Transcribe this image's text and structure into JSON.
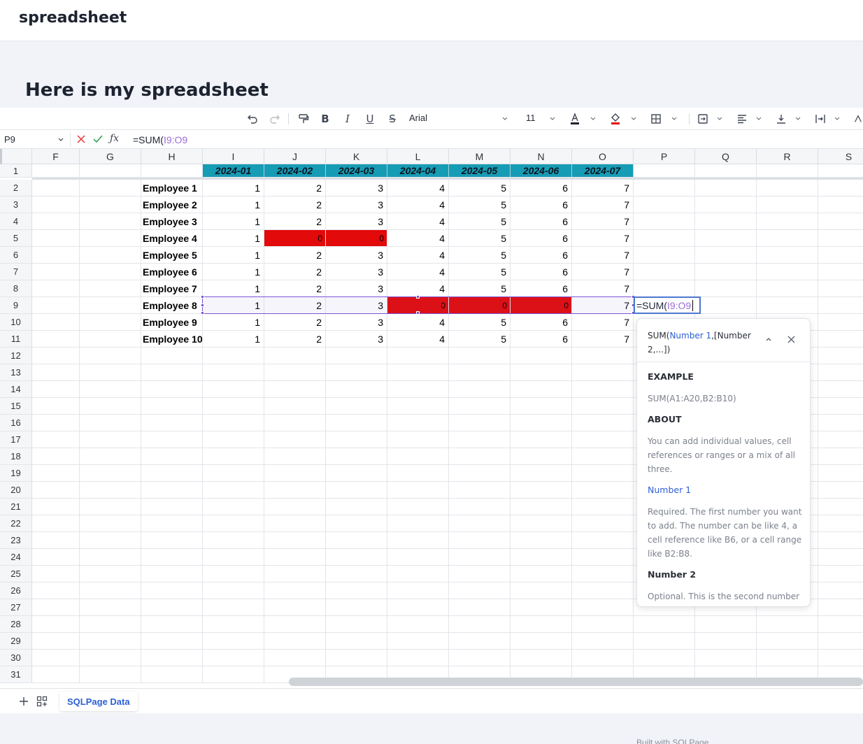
{
  "app": {
    "brand": "spreadsheet",
    "page_title": "Here is my spreadsheet",
    "footer": "Built with SQLPage"
  },
  "toolbar": {
    "font": "Arial",
    "font_size": "11"
  },
  "formula_bar": {
    "name_box": "P9",
    "formula_prefix": "=SUM(",
    "formula_ref": "I9:O9"
  },
  "columns": [
    "F",
    "G",
    "H",
    "I",
    "J",
    "K",
    "L",
    "M",
    "N",
    "O",
    "P",
    "Q",
    "R",
    "S"
  ],
  "rows": [
    "1",
    "2",
    "3",
    "4",
    "5",
    "6",
    "7",
    "8",
    "9",
    "10",
    "11",
    "12",
    "13",
    "14",
    "15",
    "16",
    "17",
    "18",
    "19",
    "20",
    "21",
    "22",
    "23",
    "24",
    "25",
    "26",
    "27",
    "28",
    "29",
    "30",
    "31"
  ],
  "months": [
    "2024-01",
    "2024-02",
    "2024-03",
    "2024-04",
    "2024-05",
    "2024-06",
    "2024-07"
  ],
  "employees": [
    {
      "name": "Employee 1",
      "values": [
        "1",
        "2",
        "3",
        "4",
        "5",
        "6",
        "7"
      ]
    },
    {
      "name": "Employee 2",
      "values": [
        "1",
        "2",
        "3",
        "4",
        "5",
        "6",
        "7"
      ]
    },
    {
      "name": "Employee 3",
      "values": [
        "1",
        "2",
        "3",
        "4",
        "5",
        "6",
        "7"
      ]
    },
    {
      "name": "Employee 4",
      "values": [
        "1",
        "0",
        "0",
        "4",
        "5",
        "6",
        "7"
      ]
    },
    {
      "name": "Employee 5",
      "values": [
        "1",
        "2",
        "3",
        "4",
        "5",
        "6",
        "7"
      ]
    },
    {
      "name": "Employee 6",
      "values": [
        "1",
        "2",
        "3",
        "4",
        "5",
        "6",
        "7"
      ]
    },
    {
      "name": "Employee 7",
      "values": [
        "1",
        "2",
        "3",
        "4",
        "5",
        "6",
        "7"
      ]
    },
    {
      "name": "Employee 8",
      "values": [
        "1",
        "2",
        "3",
        "0",
        "0",
        "0",
        "7"
      ]
    },
    {
      "name": "Employee 9",
      "values": [
        "1",
        "2",
        "3",
        "4",
        "5",
        "6",
        "7"
      ]
    },
    {
      "name": "Employee 10",
      "values": [
        "1",
        "2",
        "3",
        "4",
        "5",
        "6",
        "7"
      ]
    }
  ],
  "highlight_color": "#e20a0a",
  "header_color": "#179cb5",
  "editor": {
    "prefix": "=SUM(",
    "ref": "I9:O9"
  },
  "popup": {
    "sig_fn": "SUM(",
    "sig_param1": "Number 1",
    "sig_rest": ",[Number 2,...])",
    "example_title": "EXAMPLE",
    "example": "SUM(A1:A20,B2:B10)",
    "about_title": "ABOUT",
    "about": "You can add individual values, cell references or ranges or a mix of all three.",
    "param1_name": "Number 1",
    "param1_desc": "Required. The first number you want to add. The number can be like 4, a cell reference like B6, or a cell range like B2:B8.",
    "param2_name": "Number 2",
    "param2_desc": "Optional. This is the second number you want to add. You can specify up"
  },
  "sheet_tab": "SQLPage Data"
}
